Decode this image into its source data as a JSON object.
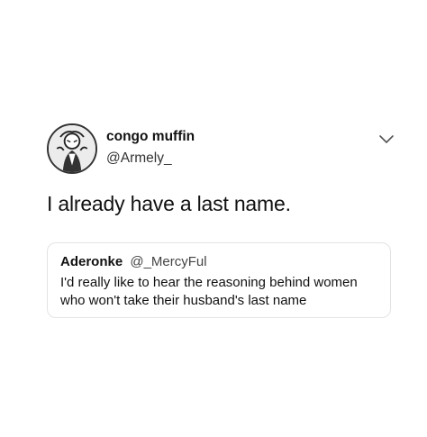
{
  "tweet": {
    "author": {
      "display_name": "congo muffin",
      "handle": "@Armely_",
      "avatar_icon": "avatar-illustration-icon"
    },
    "menu_icon": "chevron-down-icon",
    "text": "I already have a last name.",
    "quoted_tweet": {
      "display_name": "Aderonke",
      "handle": "@_MercyFul",
      "text": "I'd really like to hear the reasoning behind women who won't take their husband's last name"
    }
  }
}
